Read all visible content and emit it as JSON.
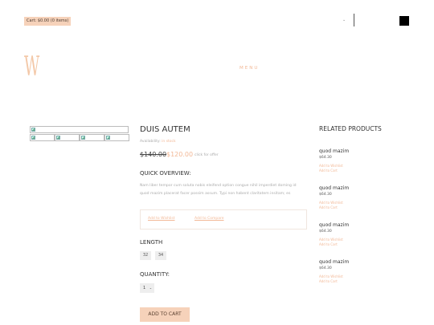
{
  "header": {
    "cart_label": "Cart: $0.00 (0 items)",
    "chevron": "⌄",
    "logo_letter": "W",
    "menu_label": "MENU"
  },
  "product": {
    "title": "DUIS AUTEM",
    "availability_label": "Availability:",
    "availability_value": "in stock",
    "old_price": "$140.00",
    "new_price": "$120.00",
    "offer_text": "click for offer",
    "overview_heading": "QUICK OVERVIEW:",
    "overview_text": "Nam liber tempor cum soluta nobis eleifend option congue nihil imperdiet doming id quod mazim placerat facer possim assum. Typi non habent claritatem insitam; es",
    "wishlist_link": "Add to Wishlist",
    "compare_link": "Add to Compare",
    "length_heading": "LENGTH",
    "sizes": [
      "32",
      "34"
    ],
    "quantity_heading": "QUANTITY:",
    "quantity_value": "1",
    "add_to_cart": "ADD TO CART"
  },
  "related": {
    "heading": "RELATED PRODUCTS",
    "items": [
      {
        "name": "quod mazim",
        "price": "$64.30",
        "wishlist": "Add to Wishlist",
        "cart": "Add to Cart"
      },
      {
        "name": "quod mazim",
        "price": "$64.30",
        "wishlist": "Add to Wishlist",
        "cart": "Add to Cart"
      },
      {
        "name": "quod mazim",
        "price": "$64.30",
        "wishlist": "Add to Wishlist",
        "cart": "Add to Cart"
      },
      {
        "name": "quod mazim",
        "price": "$64.30",
        "wishlist": "Add to Wishlist",
        "cart": "Add to Cart"
      }
    ]
  },
  "colors": {
    "accent": "#f6d2ba",
    "link": "#f2b896"
  }
}
